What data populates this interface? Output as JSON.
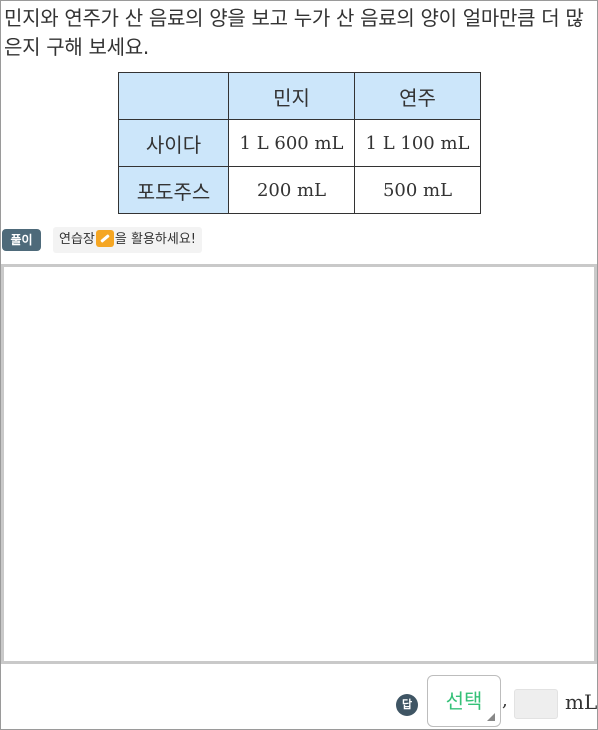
{
  "question": {
    "text": "민지와 연주가 산 음료의 양을 보고 누가 산 음료의 양이 얼마만큼 더 많은지 구해 보세요."
  },
  "table": {
    "headers": [
      "",
      "민지",
      "연주"
    ],
    "rows": [
      {
        "label": "사이다",
        "values": [
          "1 L 600 mL",
          "1 L 100 mL"
        ]
      },
      {
        "label": "포도주스",
        "values": [
          "200 mL",
          "500 mL"
        ]
      }
    ]
  },
  "solution": {
    "badge": "풀이",
    "hint_before": "연습장",
    "hint_after": "을 활용하세요!"
  },
  "answer": {
    "badge": "답",
    "select_label": "선택",
    "separator": ",",
    "unit": "mL"
  },
  "colors": {
    "header_bg": "#cce6fa",
    "select_text": "#35c178",
    "badge_bg": "#4e6a7a",
    "pad_icon": "#f5a623"
  },
  "icons": [
    "pad-icon",
    "dropdown-corner-icon"
  ]
}
